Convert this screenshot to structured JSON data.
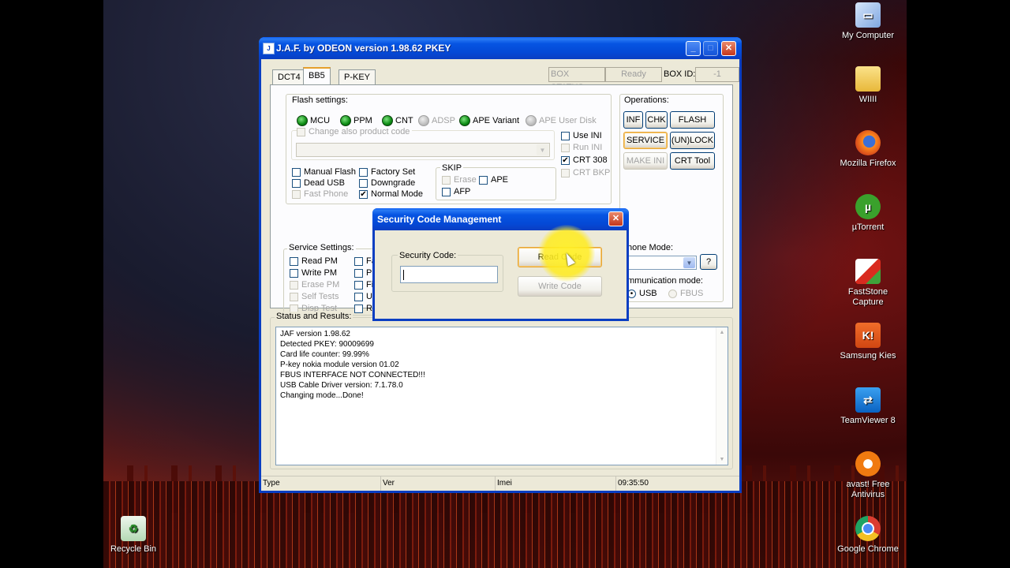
{
  "desktop": {
    "icons": [
      {
        "label": "My Computer",
        "icon": "computer-icon"
      },
      {
        "label": "WIIII",
        "icon": "folder-icon"
      },
      {
        "label": "Mozilla Firefox",
        "icon": "firefox-icon"
      },
      {
        "label": "µTorrent",
        "icon": "utorrent-icon"
      },
      {
        "label": "FastStone Capture",
        "icon": "faststone-icon"
      },
      {
        "label": "Samsung Kies",
        "icon": "kies-icon"
      },
      {
        "label": "TeamViewer 8",
        "icon": "teamviewer-icon"
      },
      {
        "label": "avast! Free Antivirus",
        "icon": "avast-icon"
      },
      {
        "label": "Google Chrome",
        "icon": "chrome-icon"
      },
      {
        "label": "Recycle Bin",
        "icon": "recycle-bin-icon"
      }
    ]
  },
  "window": {
    "title": "J.A.F. by ODEON version 1.98.62 PKEY",
    "tabs": [
      {
        "label": "DCT4",
        "active": false
      },
      {
        "label": "BB5",
        "active": true
      },
      {
        "label": "P-KEY",
        "active": false
      }
    ],
    "box_status_label": "BOX STATUS:",
    "box_status_value": "Ready",
    "box_id_label": "BOX ID:",
    "box_id_value": "-1",
    "flash_settings": {
      "label": "Flash settings:",
      "leds": [
        {
          "label": "MCU",
          "enabled": true
        },
        {
          "label": "PPM",
          "enabled": true
        },
        {
          "label": "CNT",
          "enabled": true
        },
        {
          "label": "ADSP",
          "enabled": false
        },
        {
          "label": "APE Variant",
          "enabled": true
        },
        {
          "label": "APE User Disk",
          "enabled": false
        }
      ],
      "change_product_code": "Change also product code",
      "ini_checks": [
        {
          "label": "Use INI",
          "checked": false,
          "enabled": true
        },
        {
          "label": "Run INI",
          "checked": false,
          "enabled": false
        },
        {
          "label": "CRT 308",
          "checked": true,
          "enabled": true
        },
        {
          "label": "CRT BKP",
          "checked": false,
          "enabled": false
        }
      ],
      "mode_checks": [
        {
          "label": "Manual Flash",
          "checked": false,
          "enabled": true
        },
        {
          "label": "Factory Set",
          "checked": false,
          "enabled": true
        },
        {
          "label": "Dead USB",
          "checked": false,
          "enabled": true
        },
        {
          "label": "Downgrade",
          "checked": false,
          "enabled": true
        },
        {
          "label": "Fast Phone",
          "checked": false,
          "enabled": false
        },
        {
          "label": "Normal Mode",
          "checked": true,
          "enabled": true
        }
      ],
      "skip": {
        "label": "SKIP",
        "items": [
          {
            "label": "Erase",
            "checked": false,
            "enabled": false
          },
          {
            "label": "APE",
            "checked": false,
            "enabled": true
          },
          {
            "label": "AFP",
            "checked": false,
            "enabled": true
          }
        ]
      }
    },
    "operations": {
      "label": "Operations:",
      "buttons": [
        {
          "label": "INF",
          "enabled": true
        },
        {
          "label": "CHK",
          "enabled": true
        },
        {
          "label": "FLASH",
          "enabled": true
        },
        {
          "label": "SERVICE",
          "enabled": true
        },
        {
          "label": "(UN)LOCK",
          "enabled": true
        },
        {
          "label": "MAKE INI",
          "enabled": false
        },
        {
          "label": "CRT Tool",
          "enabled": true
        }
      ],
      "phone_mode_label": "hone Mode:",
      "phone_mode_button": "?",
      "comm_mode_label": "mmunication mode:",
      "comm_usb": "USB",
      "comm_fbus": "FBUS"
    },
    "service_settings": {
      "label": "Service Settings:",
      "items": [
        {
          "label": "Read PM",
          "enabled": true
        },
        {
          "label": "Write PM",
          "enabled": true
        },
        {
          "label": "Erase PM",
          "enabled": false
        },
        {
          "label": "Self Tests",
          "enabled": false
        },
        {
          "label": "Disp Test",
          "enabled": false
        }
      ],
      "second_col_fragments": [
        "Fa",
        "Pr",
        "Fi",
        "Up",
        "Re"
      ]
    },
    "status": {
      "label": "Status and Results:",
      "lines": [
        "JAF version 1.98.62",
        "Detected PKEY: 90009699",
        "Card life counter: 99.99%",
        "P-key nokia module version 01.02",
        "FBUS INTERFACE NOT CONNECTED!!!",
        "USB Cable Driver version: 7.1.78.0",
        "Changing mode...Done!"
      ]
    },
    "statusbar": {
      "type": "Type",
      "ver": "Ver",
      "imei": "Imei",
      "time": "09:35:50"
    }
  },
  "dialog": {
    "title": "Security Code Management",
    "field_label": "Security Code:",
    "field_value": "",
    "read_button": "Read Code",
    "write_button": "Write Code"
  }
}
